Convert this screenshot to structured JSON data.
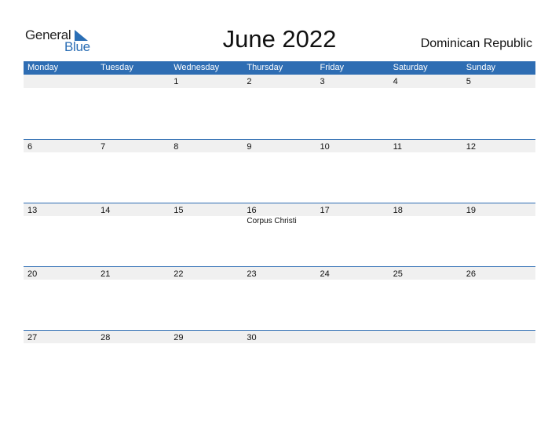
{
  "logo": {
    "line1": "General",
    "line2": "Blue"
  },
  "title": "June 2022",
  "country": "Dominican Republic",
  "colors": {
    "accent": "#2e6db3",
    "strip": "#f0f0f0"
  },
  "weekdays": [
    "Monday",
    "Tuesday",
    "Wednesday",
    "Thursday",
    "Friday",
    "Saturday",
    "Sunday"
  ],
  "weeks": [
    {
      "days": [
        "",
        "",
        "1",
        "2",
        "3",
        "4",
        "5"
      ],
      "events": [
        "",
        "",
        "",
        "",
        "",
        "",
        ""
      ]
    },
    {
      "days": [
        "6",
        "7",
        "8",
        "9",
        "10",
        "11",
        "12"
      ],
      "events": [
        "",
        "",
        "",
        "",
        "",
        "",
        ""
      ]
    },
    {
      "days": [
        "13",
        "14",
        "15",
        "16",
        "17",
        "18",
        "19"
      ],
      "events": [
        "",
        "",
        "",
        "Corpus Christi",
        "",
        "",
        ""
      ]
    },
    {
      "days": [
        "20",
        "21",
        "22",
        "23",
        "24",
        "25",
        "26"
      ],
      "events": [
        "",
        "",
        "",
        "",
        "",
        "",
        ""
      ]
    },
    {
      "days": [
        "27",
        "28",
        "29",
        "30",
        "",
        "",
        ""
      ],
      "events": [
        "",
        "",
        "",
        "",
        "",
        "",
        ""
      ]
    }
  ]
}
